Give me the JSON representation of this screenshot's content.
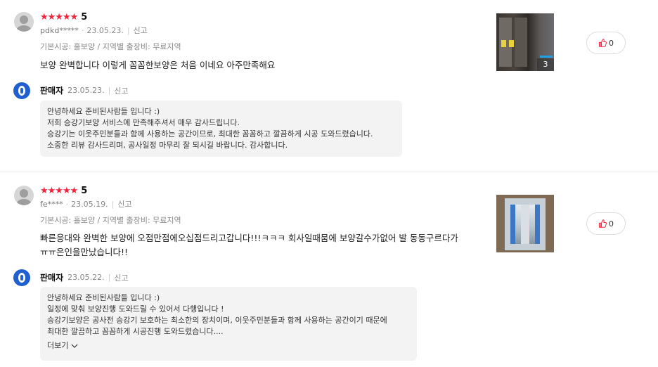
{
  "reviews": [
    {
      "rating_stars": "★★★★★",
      "score": "5",
      "user": "pdkd*****",
      "date": "23.05.23.",
      "report": "신고",
      "option": "기본시공: 홀보양 / 지역별 출장비: 무료지역",
      "content_lines": [
        "보양 완벽합니다 이렇게 꼼꼼한보양은 처음 이네요  아주만족해요"
      ],
      "photo_count": "3",
      "likes": "0",
      "seller": {
        "name": "판매자",
        "date": "23.05.23.",
        "report": "신고",
        "reply_lines": [
          "안녕하세요 준비된사람들 입니다 :)",
          "저희 승강기보양 서비스에 만족해주셔서 매우 감사드립니다.",
          "승강기는 이웃주민분들과 함께 사용하는 공간이므로, 최대한 꼼꼼하고 깔끔하게 시공 도와드렸습니다.",
          "소중한 리뷰 감사드리며, 공사일정 마무리 잘 되시길 바랍니다. 감사합니다."
        ]
      }
    },
    {
      "rating_stars": "★★★★★",
      "score": "5",
      "user": "fe****",
      "date": "23.05.19.",
      "report": "신고",
      "option": "기본시공: 홀보양 / 지역별 출장비: 무료지역",
      "content_lines": [
        "빠른응대와 완벽한 보양에 오점만점에오십점드리고갑니다!!!ㅋㅋㅋ 회사일때뭄에 보양갈수가없어 발 동동구르다가",
        "ㅠㅠ은인을만났습니다!!"
      ],
      "likes": "0",
      "seller": {
        "name": "판매자",
        "date": "23.05.22.",
        "report": "신고",
        "reply_lines": [
          "안녕하세요 준비된사람들 입니다 :)",
          "일정에 맞춰 보양진행 도와드릴 수 있어서 다행입니다 !",
          "승강기보양은 공사전 승강기 보호하는 최소한의 장치이며, 이웃주민분들과 함께 사용하는 공간이기 때문에",
          "최대한 깔끔하고 꼼꼼하게 시공진행 도와드렸습니다...."
        ],
        "more_label": "더보기"
      }
    }
  ],
  "colors": {
    "star": "#f4233d",
    "seller_badge": "#1f5fd0",
    "like_thumb": "#f4233d"
  }
}
